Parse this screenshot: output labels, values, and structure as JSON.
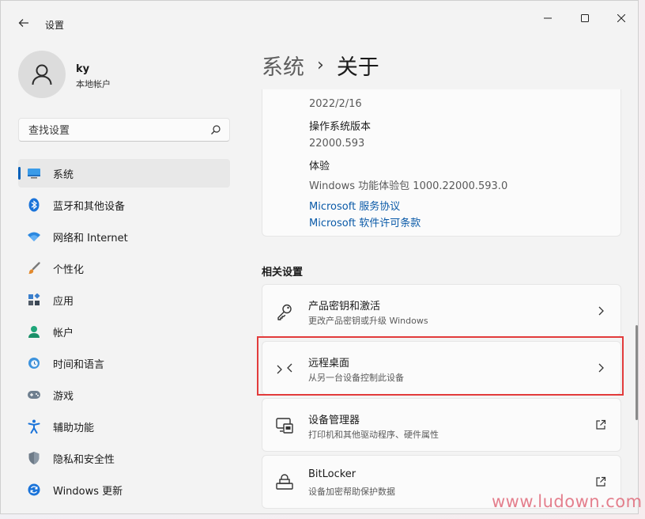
{
  "window": {
    "title": "设置",
    "controls": [
      "minimize-icon",
      "maximize-icon",
      "close-icon"
    ]
  },
  "user": {
    "name": "ky",
    "account": "本地帐户"
  },
  "search": {
    "placeholder": "查找设置",
    "icon": "search-icon"
  },
  "sidebar": {
    "items": [
      {
        "label": "系统",
        "icon": "system-display-icon",
        "active": true
      },
      {
        "label": "蓝牙和其他设备",
        "icon": "bluetooth-icon"
      },
      {
        "label": "网络和 Internet",
        "icon": "wifi-icon"
      },
      {
        "label": "个性化",
        "icon": "brush-icon"
      },
      {
        "label": "应用",
        "icon": "apps-icon"
      },
      {
        "label": "帐户",
        "icon": "account-icon"
      },
      {
        "label": "时间和语言",
        "icon": "clock-globe-icon"
      },
      {
        "label": "游戏",
        "icon": "gamepad-icon"
      },
      {
        "label": "辅助功能",
        "icon": "accessibility-icon"
      },
      {
        "label": "隐私和安全性",
        "icon": "shield-icon"
      },
      {
        "label": "Windows 更新",
        "icon": "update-icon"
      }
    ]
  },
  "breadcrumb": {
    "parent": "系统",
    "separator": "›",
    "current": "关于"
  },
  "info": {
    "install_date": "2022/2/16",
    "os_build_label": "操作系统版本",
    "os_build_value": "22000.593",
    "experience_label": "体验",
    "experience_value": "Windows 功能体验包 1000.22000.593.0",
    "link_service": "Microsoft 服务协议",
    "link_license": "Microsoft 软件许可条款"
  },
  "related": {
    "title": "相关设置",
    "items": [
      {
        "title": "产品密钥和激活",
        "subtitle": "更改产品密钥或升级 Windows",
        "icon": "key-icon",
        "action": "chevron-right-icon"
      },
      {
        "title": "远程桌面",
        "subtitle": "从另一台设备控制此设备",
        "icon": "remote-desktop-icon",
        "action": "chevron-right-icon",
        "highlighted": true
      },
      {
        "title": "设备管理器",
        "subtitle": "打印机和其他驱动程序、硬件属性",
        "icon": "device-manager-icon",
        "action": "external-link-icon"
      },
      {
        "title": "BitLocker",
        "subtitle": "设备加密帮助保护数据",
        "icon": "bitlocker-icon",
        "action": "external-link-icon"
      }
    ]
  },
  "colors": {
    "accent": "#005fb8",
    "link": "#0a5aa8",
    "highlight_border": "#e23b3b"
  },
  "watermark": "www.ludown.com"
}
